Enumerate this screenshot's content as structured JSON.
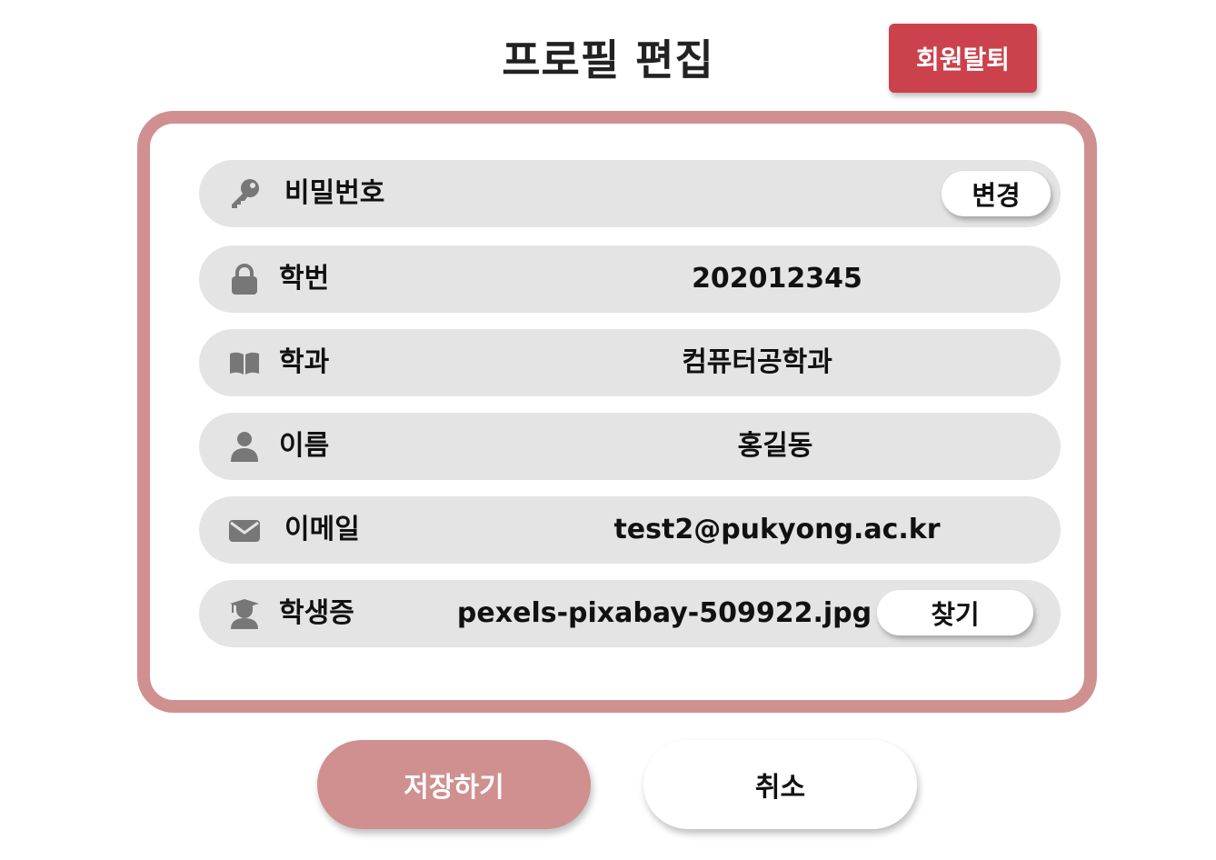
{
  "header": {
    "title": "프로필 편집",
    "withdraw_label": "회원탈퇴"
  },
  "colors": {
    "accent": "#d09090",
    "danger": "#cc424c",
    "row_bg": "#e4e4e4",
    "icon": "#777777"
  },
  "fields": [
    {
      "icon": "key-icon",
      "label": "비밀번호",
      "value": "",
      "button": "변경"
    },
    {
      "icon": "lock-icon",
      "label": "학번",
      "value": "202012345"
    },
    {
      "icon": "book-icon",
      "label": "학과",
      "value": "컴퓨터공학과"
    },
    {
      "icon": "user-icon",
      "label": "이름",
      "value": "홍길동"
    },
    {
      "icon": "envelope-icon",
      "label": "이메일",
      "value": "test2@pukyong.ac.kr"
    },
    {
      "icon": "graduate-icon",
      "label": "학생증",
      "value": "pexels-pixabay-509922.jpg",
      "button": "찾기"
    }
  ],
  "footer": {
    "save_label": "저장하기",
    "cancel_label": "취소"
  }
}
